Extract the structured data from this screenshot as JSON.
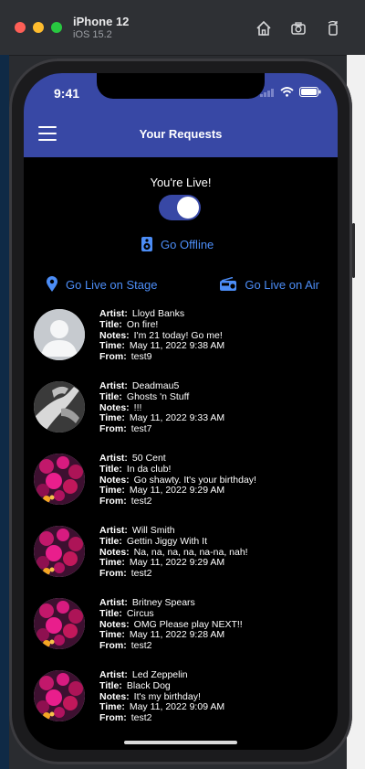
{
  "simulator": {
    "device": "iPhone 12",
    "os": "iOS 15.2",
    "tools": [
      "home-icon",
      "screenshot-icon",
      "rotate-icon"
    ]
  },
  "status": {
    "time": "9:41"
  },
  "nav": {
    "title": "Your Requests",
    "menu_icon": "hamburger-menu-icon"
  },
  "live": {
    "label": "You're Live!",
    "toggle_on": true
  },
  "actions": {
    "offline": "Go Offline",
    "live_stage": "Go Live on Stage",
    "live_air": "Go Live on Air"
  },
  "labels": {
    "artist": "Artist:",
    "title": "Title:",
    "notes": "Notes:",
    "time": "Time:",
    "from": "From:"
  },
  "requests": [
    {
      "avatar": "default-person",
      "artist": "Lloyd Banks",
      "title": "On fire!",
      "notes": "I'm 21 today! Go me!",
      "time": "May 11, 2022 9:38 AM",
      "from": "test9"
    },
    {
      "avatar": "hands-photo",
      "artist": "Deadmau5",
      "title": "Ghosts 'n Stuff",
      "notes": "!!!",
      "time": "May 11, 2022 9:33 AM",
      "from": "test7"
    },
    {
      "avatar": "flowers-photo",
      "artist": "50 Cent",
      "title": "In da club!",
      "notes": "Go shawty. It's your birthday!",
      "time": "May 11, 2022 9:29 AM",
      "from": "test2"
    },
    {
      "avatar": "flowers-photo",
      "artist": "Will Smith",
      "title": "Gettin Jiggy With It",
      "notes": "Na, na, na, na, na-na, nah!",
      "time": "May 11, 2022 9:29 AM",
      "from": "test2"
    },
    {
      "avatar": "flowers-photo",
      "artist": "Britney Spears",
      "title": "Circus",
      "notes": "OMG Please play NEXT!!",
      "time": "May 11, 2022 9:28 AM",
      "from": "test2"
    },
    {
      "avatar": "flowers-photo",
      "artist": "Led Zeppelin",
      "title": "Black Dog",
      "notes": "It's my birthday!",
      "time": "May 11, 2022 9:09 AM",
      "from": "test2"
    }
  ],
  "colors": {
    "nav": "#3848a5",
    "accent": "#4c8df6",
    "background": "#000000"
  }
}
